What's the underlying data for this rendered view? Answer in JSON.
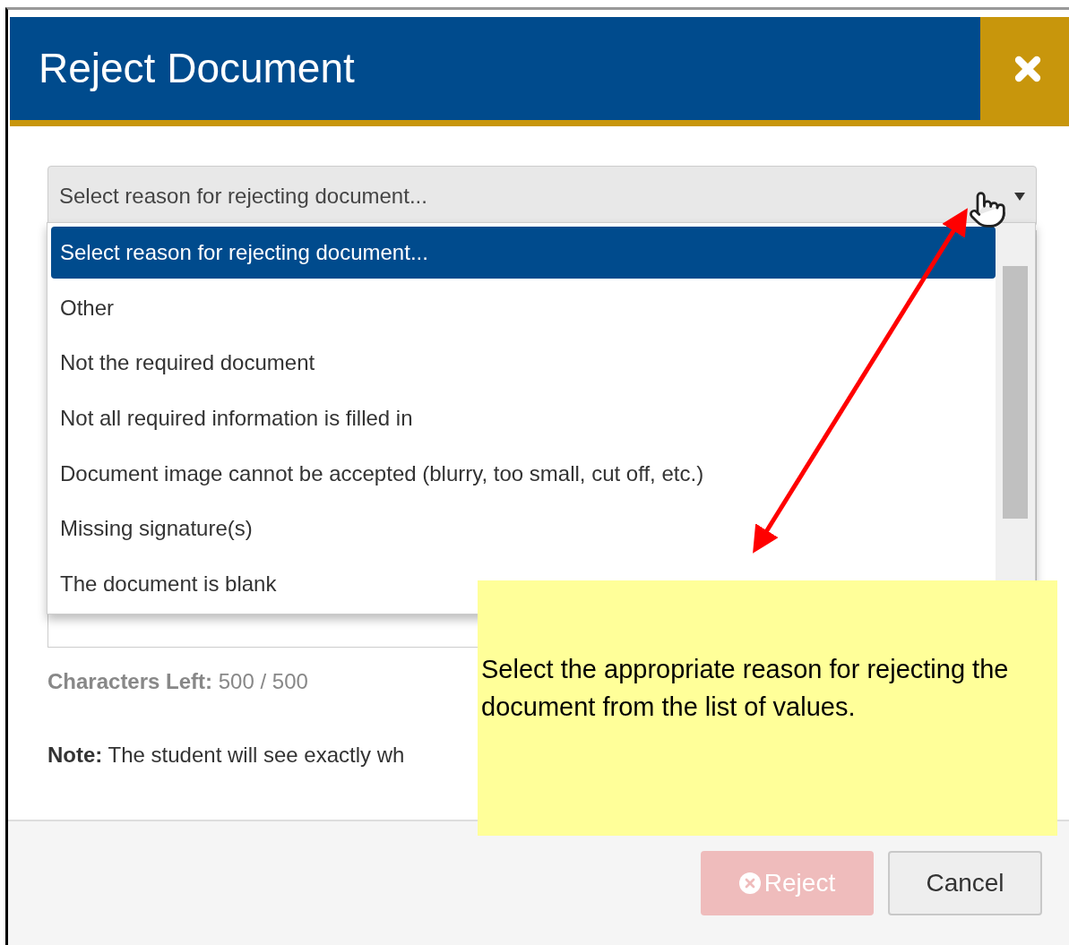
{
  "dialog": {
    "title": "Reject Document",
    "select": {
      "value": "Select reason for rejecting document...",
      "expanded": true
    },
    "options": [
      {
        "label": "Select reason for rejecting document...",
        "selected": true
      },
      {
        "label": "Other",
        "selected": false
      },
      {
        "label": "Not the required document",
        "selected": false
      },
      {
        "label": "Not all required information is filled in",
        "selected": false
      },
      {
        "label": "Document image cannot be accepted (blurry, too small, cut off, etc.)",
        "selected": false
      },
      {
        "label": "Missing signature(s)",
        "selected": false
      },
      {
        "label": "The document is blank",
        "selected": false
      }
    ],
    "characters_left": {
      "label": "Characters Left:",
      "value": "500 / 500"
    },
    "note": "**Note:** The student will see exactly wh",
    "buttons": [
      {
        "label": "Reject",
        "kind": "primary",
        "disabled": true
      },
      {
        "label": "Cancel",
        "kind": "secondary",
        "disabled": false
      }
    ]
  },
  "callout": {
    "text": "Select the appropriate reason for rejecting the document from the list of values."
  }
}
